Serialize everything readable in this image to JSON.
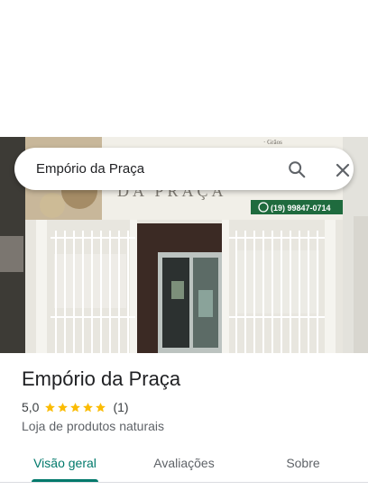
{
  "search": {
    "query": "Empório da Praça"
  },
  "photo": {
    "sign_text": "DA PRAÇA",
    "sign_phone": "(19) 99847-0714",
    "sign_items": "· Grãos"
  },
  "place": {
    "name": "Empório da Praça",
    "rating": "5,0",
    "rating_value": 5,
    "stars_max": 5,
    "review_count": "(1)",
    "category": "Loja de produtos naturais"
  },
  "tabs": [
    {
      "label": "Visão geral",
      "active": true
    },
    {
      "label": "Avaliações",
      "active": false
    },
    {
      "label": "Sobre",
      "active": false
    }
  ],
  "colors": {
    "accent": "#00796b",
    "star": "#fbbc04",
    "sign_green": "#1f6b3e"
  }
}
